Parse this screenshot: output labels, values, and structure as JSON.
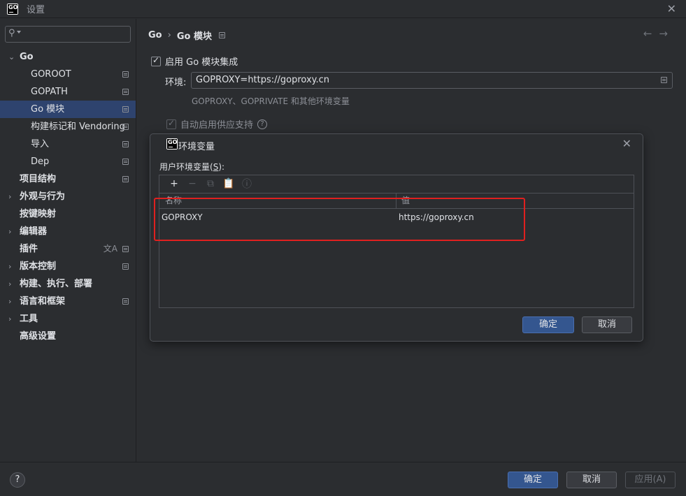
{
  "window": {
    "title": "设置",
    "logo_text": "GO"
  },
  "sidebar": {
    "search_placeholder": "",
    "items": [
      {
        "label": "Go",
        "expanded": true
      },
      {
        "label": "GOROOT"
      },
      {
        "label": "GOPATH"
      },
      {
        "label": "Go 模块",
        "selected": true
      },
      {
        "label": "构建标记和 Vendoring"
      },
      {
        "label": "导入"
      },
      {
        "label": "Dep"
      },
      {
        "label": "项目结构"
      },
      {
        "label": "外观与行为"
      },
      {
        "label": "按键映射"
      },
      {
        "label": "编辑器"
      },
      {
        "label": "插件"
      },
      {
        "label": "版本控制"
      },
      {
        "label": "构建、执行、部署"
      },
      {
        "label": "语言和框架"
      },
      {
        "label": "工具"
      },
      {
        "label": "高级设置"
      }
    ]
  },
  "main": {
    "breadcrumb": [
      "Go",
      "Go 模块"
    ],
    "enable_label": "启用 Go 模块集成",
    "env_label": "环境:",
    "env_value": "GOPROXY=https://goproxy.cn",
    "env_hint": "GOPROXY、GOPRIVATE 和其他环境变量",
    "vendor_label": "自动启用供应支持"
  },
  "dialog": {
    "title": "环境变量",
    "user_label": "用户环境变量",
    "user_label_mnemonic": "S",
    "columns": [
      "名称",
      "值"
    ],
    "rows": [
      {
        "name": "GOPROXY",
        "value": "https://goproxy.cn"
      }
    ],
    "ok": "确定",
    "cancel": "取消"
  },
  "footer": {
    "help": "?",
    "ok": "确定",
    "cancel": "取消",
    "apply": "应用(A)"
  },
  "colors": {
    "accent": "#34568f",
    "highlight": "#e0201f",
    "selection": "#2e436e"
  }
}
